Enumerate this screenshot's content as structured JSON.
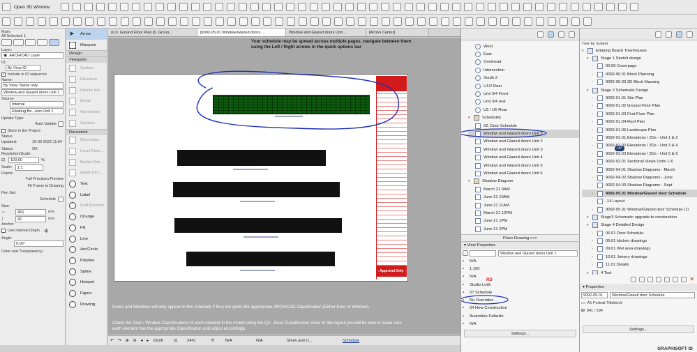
{
  "toolbar": {
    "open3d_label": "Open 3D Window"
  },
  "info_box": {
    "main_label": "Main:",
    "selected": "All Selected: 1",
    "layer_label": "Layer:",
    "layer_value": "ARCHICAD Layer",
    "id_label": "ID:",
    "by_view_id": "By View ID",
    "include_seq": "Include in ID sequence",
    "name_label": "Name:",
    "name_mode": "By View: Name only",
    "name_value": "Window and Glazed doors Unit 1",
    "source_label": "Source:",
    "source_type": "Internal",
    "source_value": "Ettalong Be...oors Unit 1",
    "update_type_label": "Update Type:",
    "update_type": "Auto Update",
    "store_in_project": "Store in the Project",
    "status_label": "Status",
    "updated_label": "Updated:",
    "updated_value": "10-03-2022 11:04",
    "status_value_label": "Status:",
    "status_value": "OK",
    "resolution_label": "Resolution/Scale:",
    "resolution_value": "100,00",
    "resolution_unit": "%",
    "scale_label": "Scale:",
    "scale_value": "1:1",
    "frame_label": "Frame:",
    "frame_preview": "Full Precision Preview",
    "frame_fit": "Fit Frame to Drawing",
    "penset_label": "Pen Set:",
    "penset_value": "Schedule",
    "size_label": "Size:",
    "width_value": "450",
    "height_value": "42",
    "size_unit": "mm",
    "anchor_label": "Anchor:",
    "use_internal_origin": "Use Internal Origin",
    "angle_label": "Angle:",
    "angle_value": "0.00°",
    "color_label": "Color and Transparency:"
  },
  "toolbox": {
    "arrow": "Arrow",
    "marquee": "Marquee",
    "design_header": "Design",
    "viewpoint_header": "Viewpoint",
    "viewpoint_items": [
      "Section",
      "Elevation",
      "Interior Ele...",
      "Detail",
      "Worksheet",
      "Camera"
    ],
    "document_header": "Document",
    "document_items": [
      "Dimension",
      "Level Dime...",
      "Radial Dim...",
      "Angle Dim..."
    ],
    "tools": [
      "Text",
      "Label",
      "Fill",
      "Change",
      "Fill",
      "Line",
      "Arc/Circle",
      "Polyline",
      "Spline",
      "Hotspot",
      "Figure",
      "Drawing"
    ],
    "grid_element": "Grid Element"
  },
  "tabs": [
    "(i) 0. Ground Floor Plan [0. Groun...",
    "[9092-05.01 Window/Glazed doors ...",
    "Window and Glazed doors Unit ...",
    "[Action Center]"
  ],
  "canvas": {
    "instruction_top": "Your schedule may be spread across multiple pages, navigate between them using the Left / Right arrows in the quick options bar",
    "note_para1": "Doors and Windows will only appear in this schedule if they are given the appropriate ARCHICAD Classification (Either Door or Window).",
    "note_para2": "Check the Door / Window Classifications of each element in the model using the QA - Door Classification View. In this layout you will be able to make sure each element has the appropriate Classification and adjust accordingly.",
    "titleblock_approval": "- Approval Only -"
  },
  "status_bar": {
    "page": "16/26",
    "zoom": "24%",
    "na1": "N/A",
    "na2": "N/A",
    "show": "Show and U...",
    "schedule": "Schedule"
  },
  "navigator_left": {
    "items": [
      {
        "label": "West",
        "type": "elev"
      },
      {
        "label": "East",
        "type": "elev"
      },
      {
        "label": "Overhead",
        "type": "elev"
      },
      {
        "label": "Intersection",
        "type": "elev"
      },
      {
        "label": "South 2",
        "type": "elev"
      },
      {
        "label": "U1/2 Rear",
        "type": "elev"
      },
      {
        "label": "Unit 3/4 Front",
        "type": "elev"
      },
      {
        "label": "Unit 3/4 rear",
        "type": "elev"
      },
      {
        "label": "U5 / U6 Rear",
        "type": "elev"
      },
      {
        "label": "Schedules",
        "type": "folder"
      },
      {
        "label": "02. Door Schedule",
        "type": "sched"
      },
      {
        "label": "Window and Glazed doors Unit 1",
        "type": "sched"
      },
      {
        "label": "Window and Glazed doors Unit 2",
        "type": "sched"
      },
      {
        "label": "Window and Glazed doors Unit 3",
        "type": "sched"
      },
      {
        "label": "Window and Glazed doors Unit 4",
        "type": "sched"
      },
      {
        "label": "Window and Glazed doors Unit 5",
        "type": "sched"
      },
      {
        "label": "Window and Glazed doors Unit 6",
        "type": "sched"
      },
      {
        "label": "Shadow Diagram",
        "type": "folder"
      },
      {
        "label": "March 21 9AM",
        "type": "view"
      },
      {
        "label": "June 21 10AM",
        "type": "view"
      },
      {
        "label": "June 21 11AM",
        "type": "view"
      },
      {
        "label": "March 21 12PM",
        "type": "view"
      },
      {
        "label": "June 21 1PM",
        "type": "view"
      },
      {
        "label": "June 21 2PM",
        "type": "view"
      }
    ],
    "place_drawing": "Place Drawing >>>",
    "view_props_header": "View Properties",
    "view_name": "Window and Glazed doors Unit 1",
    "props": [
      "N/A",
      "1:100",
      "N/A",
      "Studio Leith",
      "07 Schedule",
      "No Overrides",
      "04 New Construction",
      "Australian Defaults",
      "N/A"
    ],
    "settings": "Settings...",
    "rd_badge": "RD"
  },
  "navigator_right": {
    "header": "Tree by Subset",
    "items": [
      {
        "label": "Ettalong Beach Townhouses",
        "level": 0,
        "bold": false
      },
      {
        "label": "Stage 1 Sketch design",
        "level": 1,
        "bold": false
      },
      {
        "label": "00.00 Coverpage",
        "level": 2,
        "bold": false
      },
      {
        "label": "9092-00.01 Block Planning",
        "level": 2,
        "bold": false
      },
      {
        "label": "9092-00.03 3D Block Massing",
        "level": 2,
        "bold": false
      },
      {
        "label": "Stage 2 Schematic Design",
        "level": 1,
        "bold": false
      },
      {
        "label": "9092-01.01 Site Plan",
        "level": 2,
        "bold": false
      },
      {
        "label": "9092-01.02 Ground Floor Plan",
        "level": 2,
        "bold": false
      },
      {
        "label": "9092-01.03 First Floor Plan",
        "level": 2,
        "bold": false
      },
      {
        "label": "9092-01.04 Roof Plan",
        "level": 2,
        "bold": false
      },
      {
        "label": "9092-01.05 Landscape Plan",
        "level": 2,
        "bold": false
      },
      {
        "label": "9092-02.01 Elevations / 3Ds - Unit 1 & 2",
        "level": 2,
        "bold": false
      },
      {
        "label": "9092-02.02 Elevations / 3Ds - Unit 3 & 4",
        "level": 2,
        "bold": false
      },
      {
        "label": "9092-02.03 Elevations / 3Ds - Unit 5 & 6",
        "level": 2,
        "bold": false
      },
      {
        "label": "9092-03.01 Sectional Views Units 1-6",
        "level": 2,
        "bold": false
      },
      {
        "label": "9092-04.01 Shadow Diagrams - March",
        "level": 2,
        "bold": false
      },
      {
        "label": "9092-04.02 Shadow Diagrams - June",
        "level": 2,
        "bold": false
      },
      {
        "label": "9092-04.03 Shadow Diagrams - Sept",
        "level": 2,
        "bold": false
      },
      {
        "label": "9092-05.01 Window/Glazed door Schedule",
        "level": 2,
        "bold": true
      },
      {
        "label": "-14 Layout",
        "level": 2,
        "bold": false
      },
      {
        "label": "9092-05.01 Window/Glazed door Schedule (1)",
        "level": 2,
        "bold": false
      },
      {
        "label": "Stage3 Schematic upgrade to construction",
        "level": 1,
        "bold": false
      },
      {
        "label": "Stage 4 Detailed Design",
        "level": 1,
        "bold": false
      },
      {
        "label": "06.01 Door Schedule",
        "level": 2,
        "bold": false
      },
      {
        "label": "06.01 kitchen drawings",
        "level": 2,
        "bold": false
      },
      {
        "label": "09.01 Wet area drawings",
        "level": 2,
        "bold": false
      },
      {
        "label": "10.01 Joinery drawings",
        "level": 2,
        "bold": false
      },
      {
        "label": "11.01 Details",
        "level": 2,
        "bold": false
      },
      {
        "label": "4 Test",
        "level": 1,
        "bold": false
      }
    ],
    "hp_badge": "HP",
    "properties_header": "Properties",
    "prop_id": "9092-05.01",
    "prop_name": "Window/Glazed door Schedule",
    "prop_master": "A1 Portrait Titleblock",
    "prop_size": "841 / 594",
    "settings": "Settings...",
    "brand": "GRAPHISOFT ID"
  },
  "colors": {
    "annotation_blue": "#1d2fb8",
    "schedule_green": "#0d5b0d",
    "titleblock_red": "#d21a1a"
  }
}
